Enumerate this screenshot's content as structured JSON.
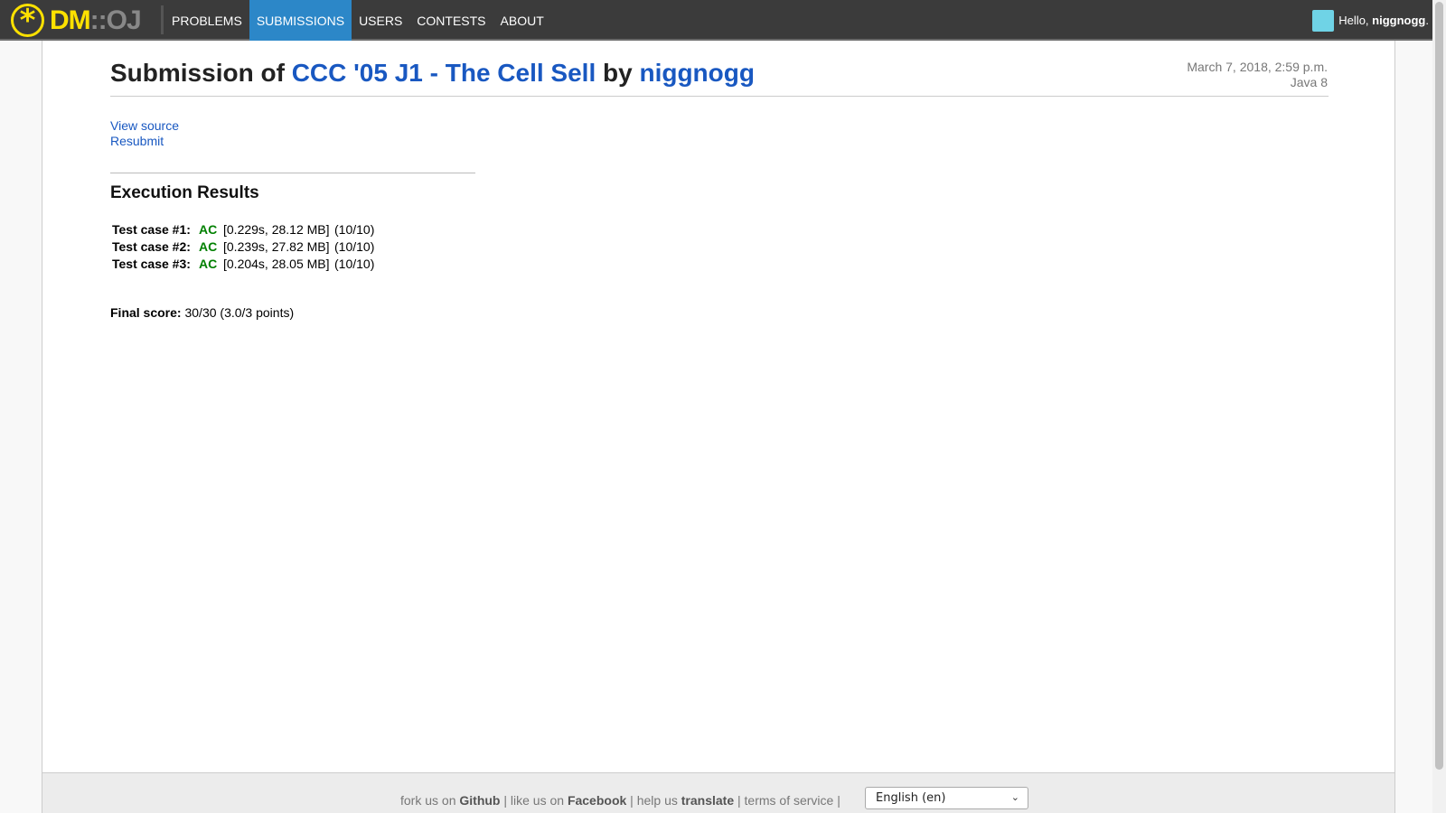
{
  "nav": {
    "logo_dm": "DM",
    "logo_colons": "::",
    "logo_oj": "OJ",
    "items": [
      {
        "label": "PROBLEMS"
      },
      {
        "label": "SUBMISSIONS"
      },
      {
        "label": "USERS"
      },
      {
        "label": "CONTESTS"
      },
      {
        "label": "ABOUT"
      }
    ],
    "active_index": 1,
    "user_greeting": "Hello, ",
    "username": "niggnogg",
    "user_suffix": "."
  },
  "submission": {
    "title_prefix": "Submission of ",
    "problem": "CCC '05 J1 - The Cell Sell",
    "by": " by ",
    "user": "niggnogg",
    "date": "March 7, 2018, 2:59 p.m.",
    "language": "Java 8",
    "view_source": "View source",
    "resubmit": "Resubmit"
  },
  "results": {
    "heading": "Execution Results",
    "cases": [
      {
        "label": "Test case #1:",
        "status": "AC",
        "resources": "[0.229s, 28.12 MB]",
        "points": "(10/10)"
      },
      {
        "label": "Test case #2:",
        "status": "AC",
        "resources": "[0.239s, 27.82 MB]",
        "points": "(10/10)"
      },
      {
        "label": "Test case #3:",
        "status": "AC",
        "resources": "[0.204s, 28.05 MB]",
        "points": "(10/10)"
      }
    ],
    "final_label": "Final score:",
    "final_value": " 30/30 (3.0/3 points)"
  },
  "footer": {
    "fork": "fork us on ",
    "github": "Github",
    "like": " | like us on ",
    "facebook": "Facebook",
    "help": " | help us ",
    "translate": "translate",
    "tos": " | terms of service |",
    "language": "English (en)"
  },
  "colors": {
    "navbar": "#3b3b3b",
    "active_tab": "#2c87c8",
    "link": "#1958c1",
    "accepted": "#008000",
    "logo_yellow": "#fde100"
  }
}
